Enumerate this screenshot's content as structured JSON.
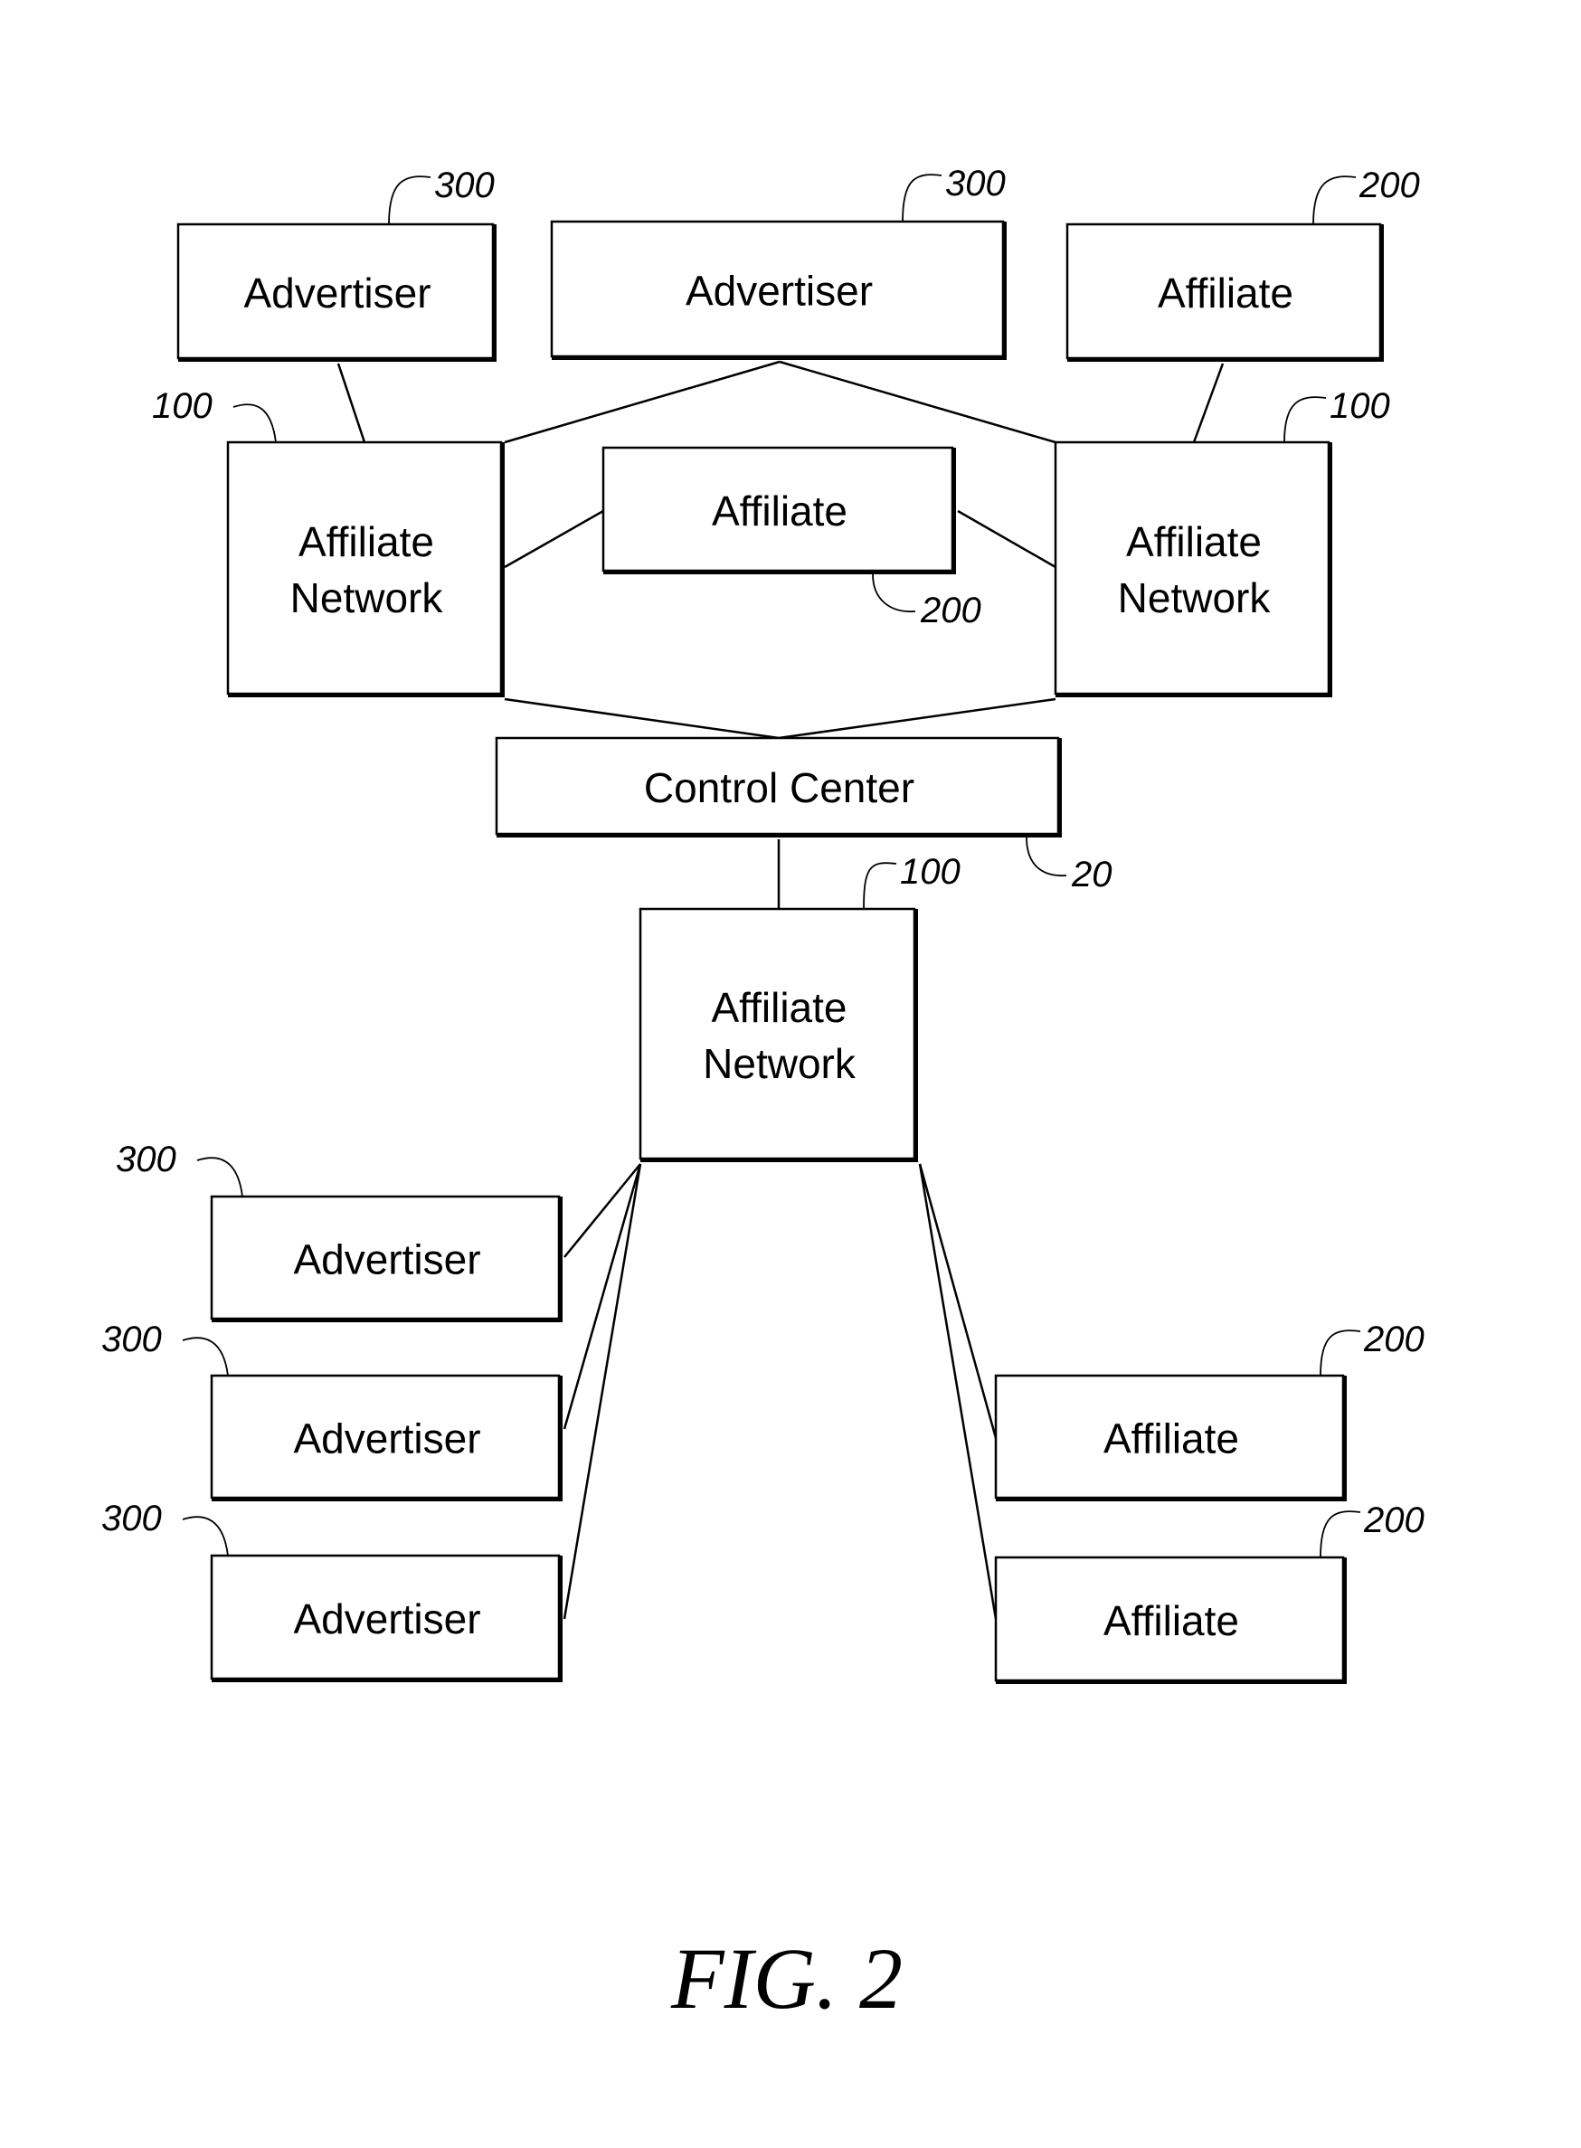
{
  "figure": {
    "caption": "FIG. 2",
    "nodes": [
      {
        "id": "adv_top_left",
        "label": [
          "Advertiser"
        ],
        "ref": "300"
      },
      {
        "id": "adv_top_mid",
        "label": [
          "Advertiser"
        ],
        "ref": "300"
      },
      {
        "id": "aff_top_right",
        "label": [
          "Affiliate"
        ],
        "ref": "200"
      },
      {
        "id": "net_left",
        "label": [
          "Affiliate",
          "Network"
        ],
        "ref": "100"
      },
      {
        "id": "aff_mid",
        "label": [
          "Affiliate"
        ],
        "ref": "200"
      },
      {
        "id": "net_right",
        "label": [
          "Affiliate",
          "Network"
        ],
        "ref": "100"
      },
      {
        "id": "control",
        "label": [
          "Control Center"
        ],
        "ref": "20"
      },
      {
        "id": "net_bottom",
        "label": [
          "Affiliate",
          "Network"
        ],
        "ref": "100"
      },
      {
        "id": "adv_l1",
        "label": [
          "Advertiser"
        ],
        "ref": "300"
      },
      {
        "id": "adv_l2",
        "label": [
          "Advertiser"
        ],
        "ref": "300"
      },
      {
        "id": "adv_l3",
        "label": [
          "Advertiser"
        ],
        "ref": "300"
      },
      {
        "id": "aff_r1",
        "label": [
          "Affiliate"
        ],
        "ref": "200"
      },
      {
        "id": "aff_r2",
        "label": [
          "Affiliate"
        ],
        "ref": "200"
      }
    ],
    "edges": [
      [
        "adv_top_left",
        "net_left"
      ],
      [
        "adv_top_mid",
        "net_left"
      ],
      [
        "adv_top_mid",
        "net_right"
      ],
      [
        "aff_top_right",
        "net_right"
      ],
      [
        "net_left",
        "aff_mid"
      ],
      [
        "aff_mid",
        "net_right"
      ],
      [
        "net_left",
        "control"
      ],
      [
        "net_right",
        "control"
      ],
      [
        "control",
        "net_bottom"
      ],
      [
        "net_bottom",
        "adv_l1"
      ],
      [
        "net_bottom",
        "adv_l2"
      ],
      [
        "net_bottom",
        "adv_l3"
      ],
      [
        "net_bottom",
        "aff_r1"
      ],
      [
        "net_bottom",
        "aff_r2"
      ]
    ]
  }
}
